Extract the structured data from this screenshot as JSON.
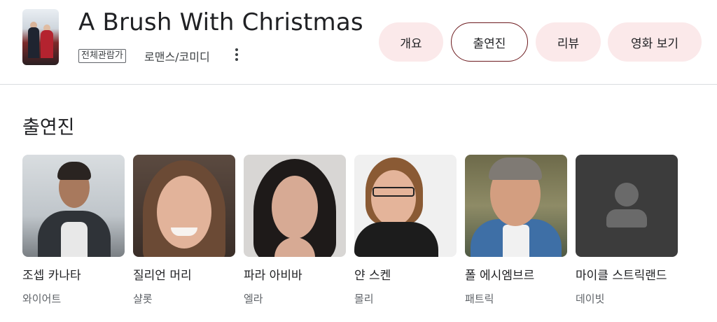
{
  "movie": {
    "title": "A Brush With Christmas",
    "rating": "전체관람가",
    "genre": "로맨스/코미디"
  },
  "tabs": [
    {
      "label": "개요",
      "active": false
    },
    {
      "label": "출연진",
      "active": true
    },
    {
      "label": "리뷰",
      "active": false
    },
    {
      "label": "영화 보기",
      "active": false
    }
  ],
  "section": {
    "title": "출연진"
  },
  "cast": [
    {
      "name": "조셉 카나타",
      "role": "와이어트",
      "photo": "actor-photo"
    },
    {
      "name": "질리언 머리",
      "role": "샬롯",
      "photo": "actress-photo"
    },
    {
      "name": "파라 아비바",
      "role": "엘라",
      "photo": "actress-photo"
    },
    {
      "name": "얀 스켄",
      "role": "몰리",
      "photo": "actress-photo"
    },
    {
      "name": "폴 에시엠브르",
      "role": "패트릭",
      "photo": "actor-photo"
    },
    {
      "name": "마이클 스트릭랜드",
      "role": "데이빗",
      "photo": "person-placeholder-icon"
    }
  ],
  "colors": {
    "tab_bg": "#fbe9ea",
    "tab_active_border": "#6d1b1f",
    "placeholder_bg": "#3c3c3c"
  }
}
